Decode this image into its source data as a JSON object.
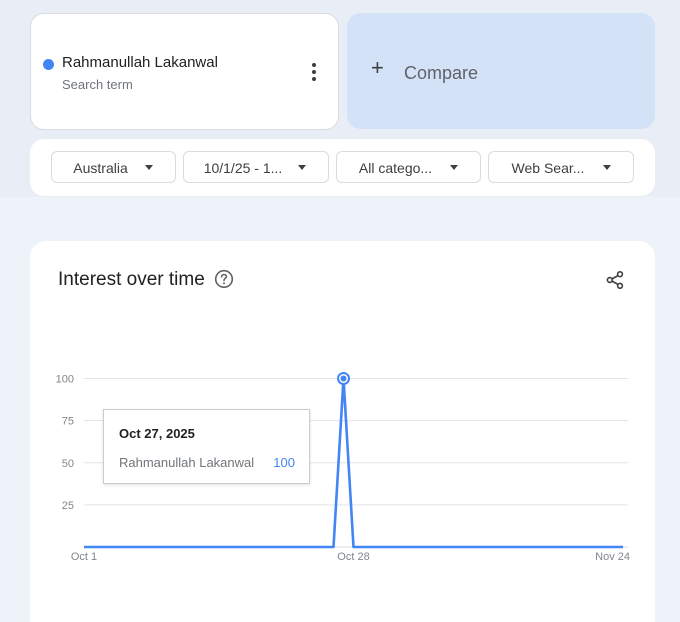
{
  "search_term": {
    "name": "Rahmanullah Lakanwal",
    "type_label": "Search term",
    "color": "#4285f4"
  },
  "compare": {
    "plus": "+",
    "label": "Compare"
  },
  "filters": [
    {
      "label": "Australia"
    },
    {
      "label": "10/1/25 - 1..."
    },
    {
      "label": "All catego..."
    },
    {
      "label": "Web Sear..."
    }
  ],
  "chart_card": {
    "title": "Interest over time",
    "help_icon": "help-circle-icon",
    "share_icon": "share-icon"
  },
  "tooltip": {
    "date": "Oct 27, 2025",
    "series": "Rahmanullah Lakanwal",
    "value": "100"
  },
  "chart_data": {
    "type": "line",
    "title": "Interest over time",
    "x_tick_labels": [
      "Oct 1",
      "Oct 28",
      "Nov 24"
    ],
    "y_ticks": [
      25,
      50,
      75,
      100
    ],
    "ylim": [
      0,
      100
    ],
    "grid": true,
    "x_start": "2025-10-01",
    "x_end": "2025-11-24",
    "series": [
      {
        "name": "Rahmanullah Lakanwal",
        "color": "#4285f4",
        "points": [
          {
            "x": "2025-10-01",
            "y": 0
          },
          {
            "x": "2025-10-25",
            "y": 0
          },
          {
            "x": "2025-10-26",
            "y": 0
          },
          {
            "x": "2025-10-27",
            "y": 100
          },
          {
            "x": "2025-10-28",
            "y": 0
          },
          {
            "x": "2025-10-29",
            "y": 0
          },
          {
            "x": "2025-11-24",
            "y": 0
          }
        ]
      }
    ],
    "highlighted_point": {
      "x": "2025-10-27",
      "y": 100
    }
  }
}
